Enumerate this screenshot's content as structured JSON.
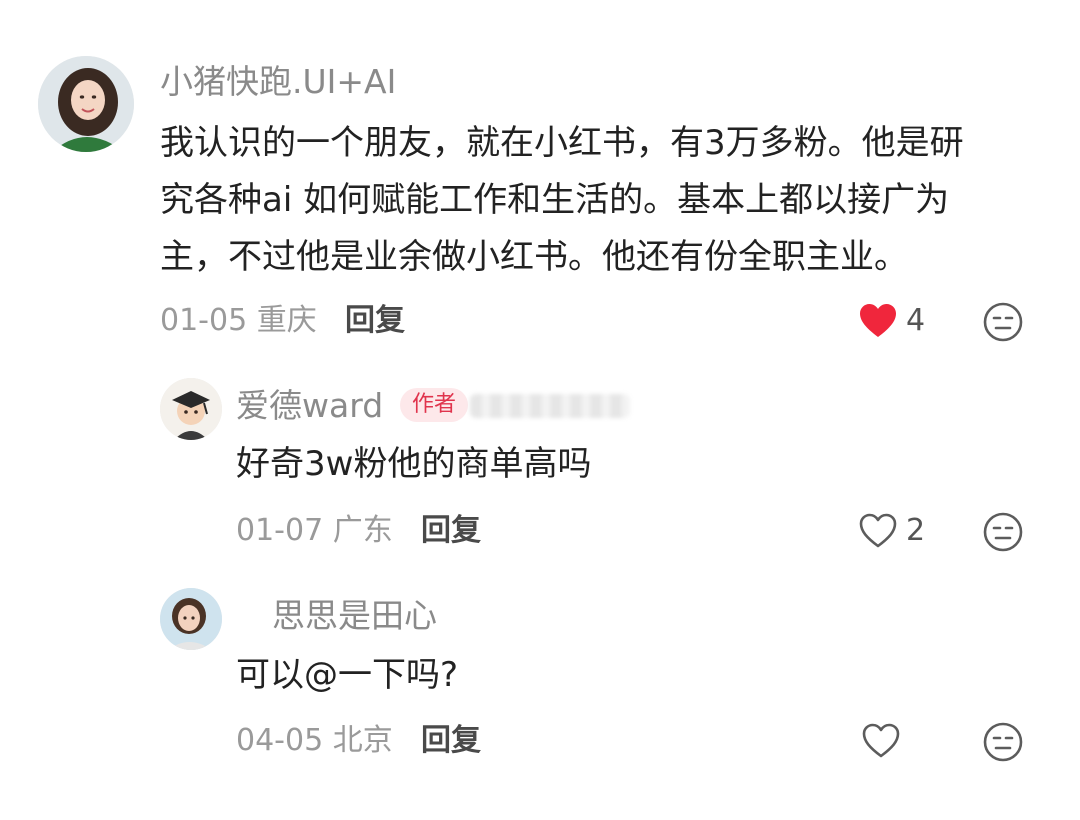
{
  "comments": [
    {
      "username": "小猪快跑.UI+AI",
      "content_lines": [
        "我认识的一个朋友，就在小红书，有3万多粉。他是研",
        "究各种ai 如何赋能工作和生活的。基本上都以接广为",
        "主，不过他是业余做小红书。他还有份全职主业。"
      ],
      "date_location": "01-05 重庆",
      "reply_label": "回复",
      "likes": "4",
      "liked": true
    },
    {
      "username": "爱德ward",
      "badge": "作者",
      "content": "好奇3w粉他的商单高吗",
      "date_location": "01-07 广东",
      "reply_label": "回复",
      "likes": "2",
      "liked": false
    },
    {
      "username": "思思是田心",
      "content": "可以@一下吗?",
      "date_location": "04-05 北京",
      "reply_label": "回复",
      "likes": "",
      "liked": false
    }
  ],
  "colors": {
    "liked_heart": "#f0263c",
    "outline_icon": "#5c5c5c",
    "author_badge_text": "#e0344d",
    "author_badge_bg": "#fde8ea"
  },
  "icons": {
    "like": "heart-icon",
    "dislike": "meh-face-icon"
  }
}
